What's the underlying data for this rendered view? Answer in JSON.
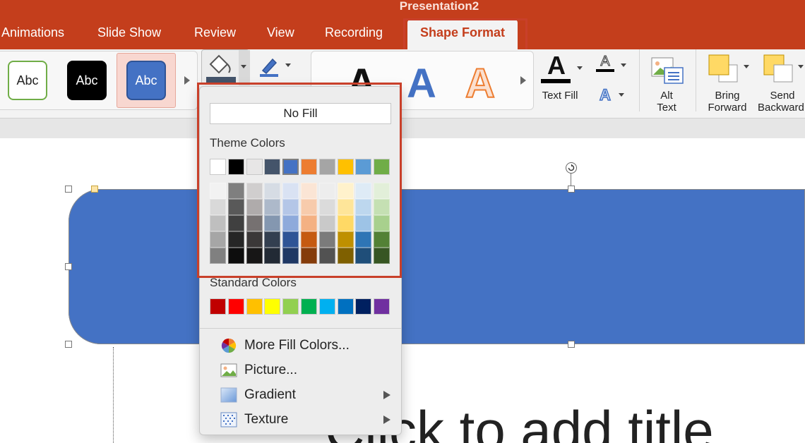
{
  "app": {
    "title": "Presentation2"
  },
  "tabs": [
    {
      "label": "Animations"
    },
    {
      "label": "Slide Show"
    },
    {
      "label": "Review"
    },
    {
      "label": "View"
    },
    {
      "label": "Recording"
    },
    {
      "label": "Shape Format",
      "active": true
    }
  ],
  "ribbon": {
    "shape_styles": [
      {
        "label": "Abc",
        "style": "white-green-outline"
      },
      {
        "label": "Abc",
        "style": "black"
      },
      {
        "label": "Abc",
        "style": "blue-selected"
      }
    ],
    "wordart": [
      {
        "glyph": "A"
      },
      {
        "glyph": "A"
      },
      {
        "glyph": "A"
      }
    ],
    "text_fill": {
      "label": "Text Fill"
    },
    "alt_text": {
      "line1": "Alt",
      "line2": "Text"
    },
    "bring_forward": {
      "line1": "Bring",
      "line2": "Forward"
    },
    "send_backward": {
      "line1": "Send",
      "line2": "Backward"
    }
  },
  "slide": {
    "title_placeholder": "Click to add title"
  },
  "fill_menu": {
    "no_fill": "No Fill",
    "theme_colors_label": "Theme Colors",
    "theme_top": [
      "#ffffff",
      "#000000",
      "#e7e6e6",
      "#44546a",
      "#4472c4",
      "#ed7d31",
      "#a5a5a5",
      "#ffc000",
      "#5b9bd5",
      "#70ad47"
    ],
    "theme_shades": [
      [
        "#f2f2f2",
        "#d9d9d9",
        "#bfbfbf",
        "#a6a6a6",
        "#808080"
      ],
      [
        "#7f7f7f",
        "#595959",
        "#404040",
        "#262626",
        "#0d0d0d"
      ],
      [
        "#d0cece",
        "#afabab",
        "#767171",
        "#3b3838",
        "#171616"
      ],
      [
        "#d6dce4",
        "#adb9ca",
        "#8497b0",
        "#333f50",
        "#222a35"
      ],
      [
        "#d9e2f3",
        "#b4c6e7",
        "#8eaadb",
        "#2f5496",
        "#1f3864"
      ],
      [
        "#fbe5d5",
        "#f7cbac",
        "#f4b183",
        "#c55a11",
        "#843c0b"
      ],
      [
        "#ededed",
        "#dbdbdb",
        "#c9c9c9",
        "#7b7b7b",
        "#525252"
      ],
      [
        "#fff2cc",
        "#fee599",
        "#ffd965",
        "#bf9000",
        "#7f6000"
      ],
      [
        "#deebf6",
        "#bdd7ee",
        "#9dc3e6",
        "#2e75b5",
        "#1f4e79"
      ],
      [
        "#e2efd9",
        "#c5e0b3",
        "#a8d08d",
        "#538135",
        "#375623"
      ]
    ],
    "selected_theme_index": 4,
    "standard_colors_label": "Standard Colors",
    "standard": [
      "#c00000",
      "#ff0000",
      "#ffc000",
      "#ffff00",
      "#92d050",
      "#00b050",
      "#00b0f0",
      "#0070c0",
      "#002060",
      "#7030a0"
    ],
    "items": [
      {
        "label": "More Fill Colors...",
        "icon": "color-wheel-icon"
      },
      {
        "label": "Picture...",
        "icon": "picture-icon"
      },
      {
        "label": "Gradient",
        "icon": "gradient-icon",
        "submenu": true
      },
      {
        "label": "Texture",
        "icon": "texture-icon",
        "submenu": true
      }
    ]
  },
  "colors": {
    "accent": "#c43e1c",
    "highlight": "#c9402a",
    "shape_fill": "#4472c4"
  }
}
